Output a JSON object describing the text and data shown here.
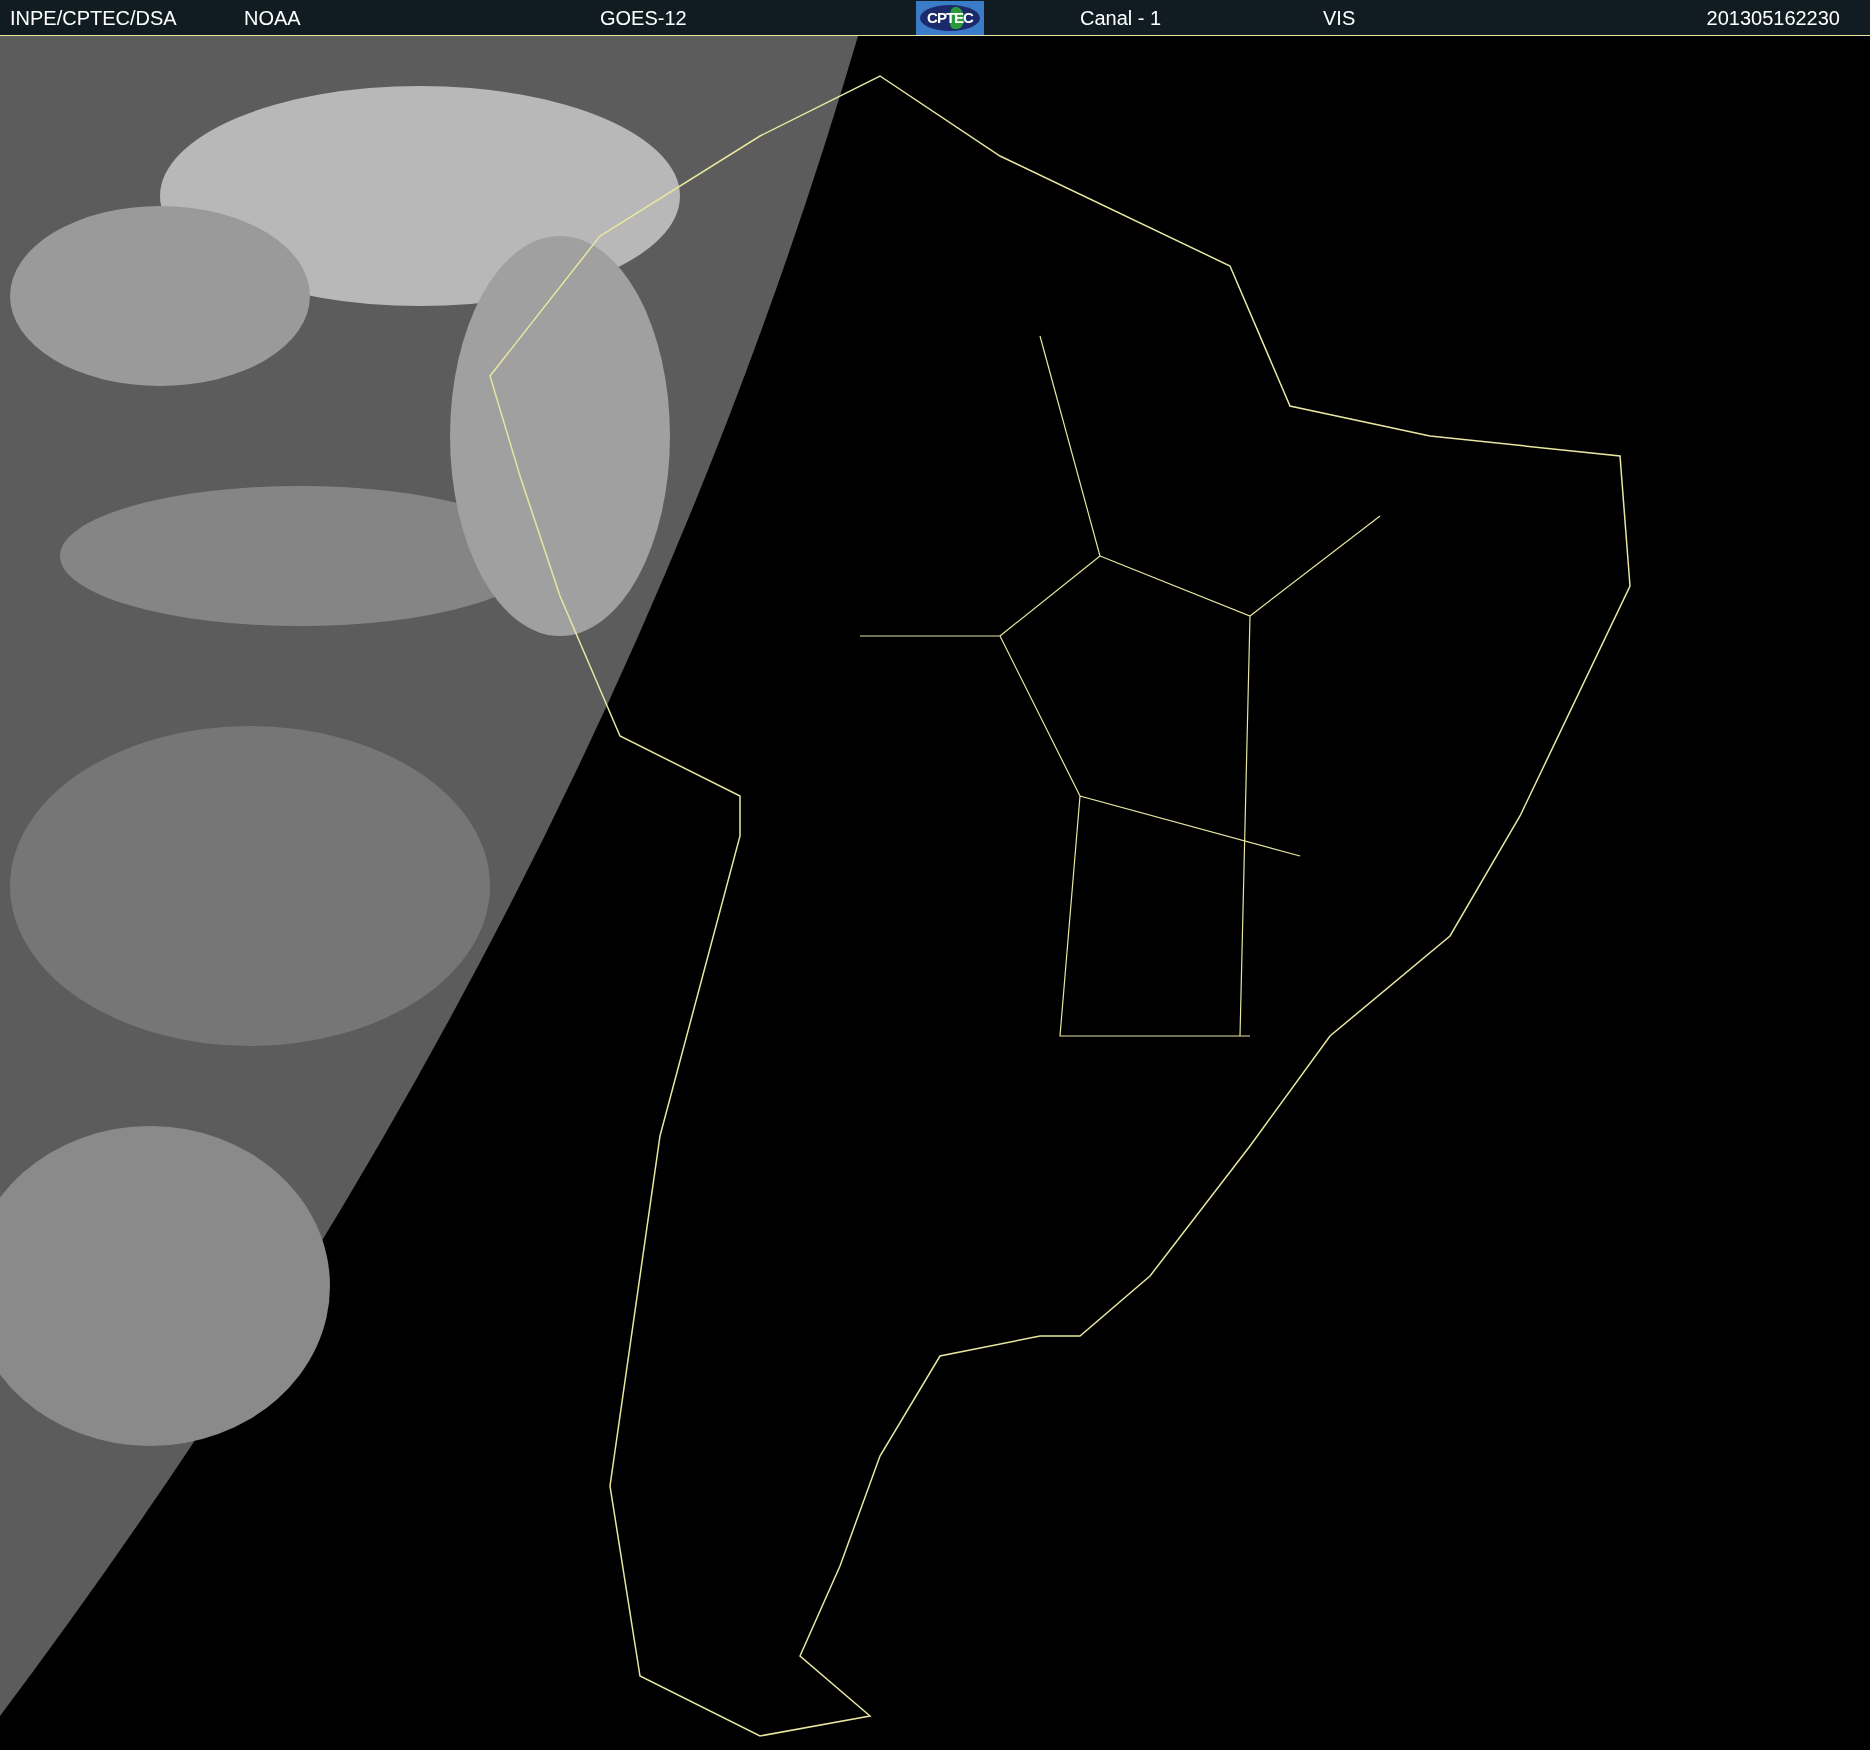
{
  "header": [
    {
      "kind": "text",
      "text": "INPE/CPTEC/DSA"
    },
    {
      "kind": "text",
      "text": "NOAA"
    },
    {
      "kind": "text",
      "text": "GOES-12"
    },
    {
      "kind": "logo",
      "text": "CPTEC"
    },
    {
      "kind": "text",
      "text": "Canal - 1"
    },
    {
      "kind": "text",
      "text": "VIS"
    },
    {
      "kind": "text",
      "text": "201305162230"
    }
  ]
}
